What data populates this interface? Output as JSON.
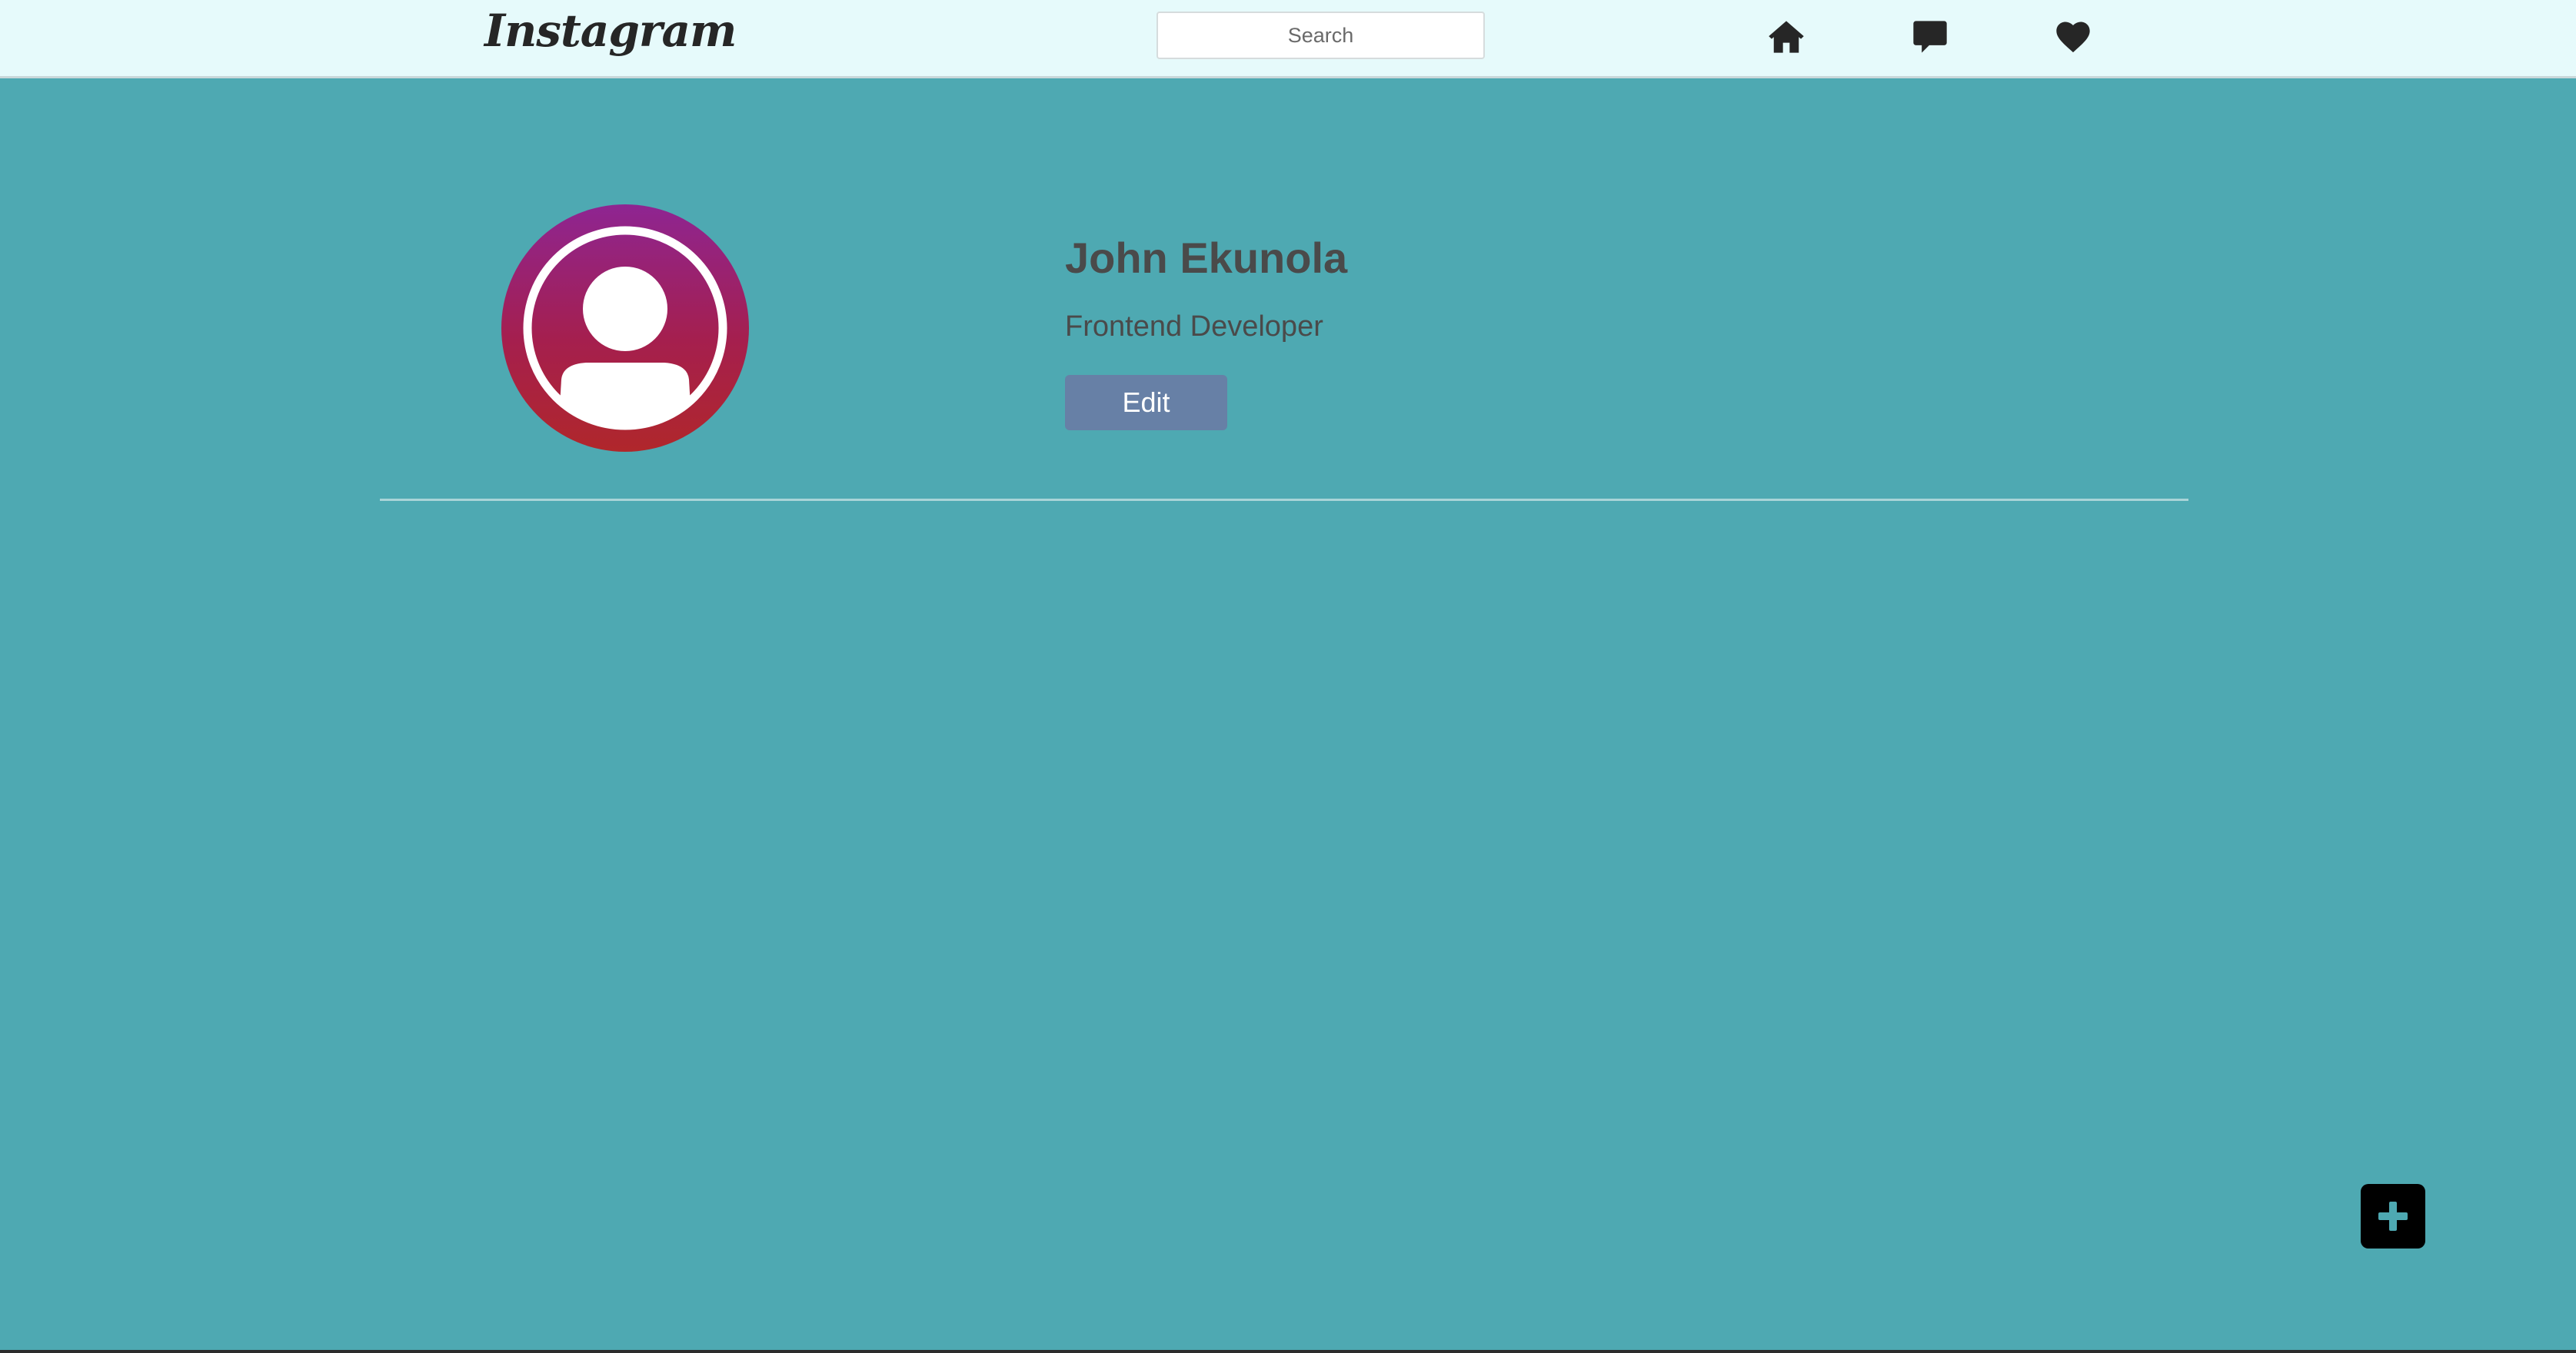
{
  "header": {
    "logo_text": "Instagram",
    "search_placeholder": "Search",
    "icons": [
      "home-icon",
      "chat-icon",
      "heart-icon"
    ]
  },
  "profile": {
    "name": "John Ekunola",
    "title": "Frontend Developer",
    "edit_label": "Edit",
    "avatar_icon": "user-icon"
  },
  "actions": {
    "add_icon": "plus-icon"
  },
  "colors": {
    "background": "#4ea9b2",
    "header_background": "#e6fafb",
    "edit_button": "#6780a6",
    "avatar_gradient_top": "#8e2592",
    "avatar_gradient_bottom": "#b0272b",
    "add_button": "#000000",
    "add_plus": "#4ea9b2",
    "text": "#4a4a4a"
  }
}
